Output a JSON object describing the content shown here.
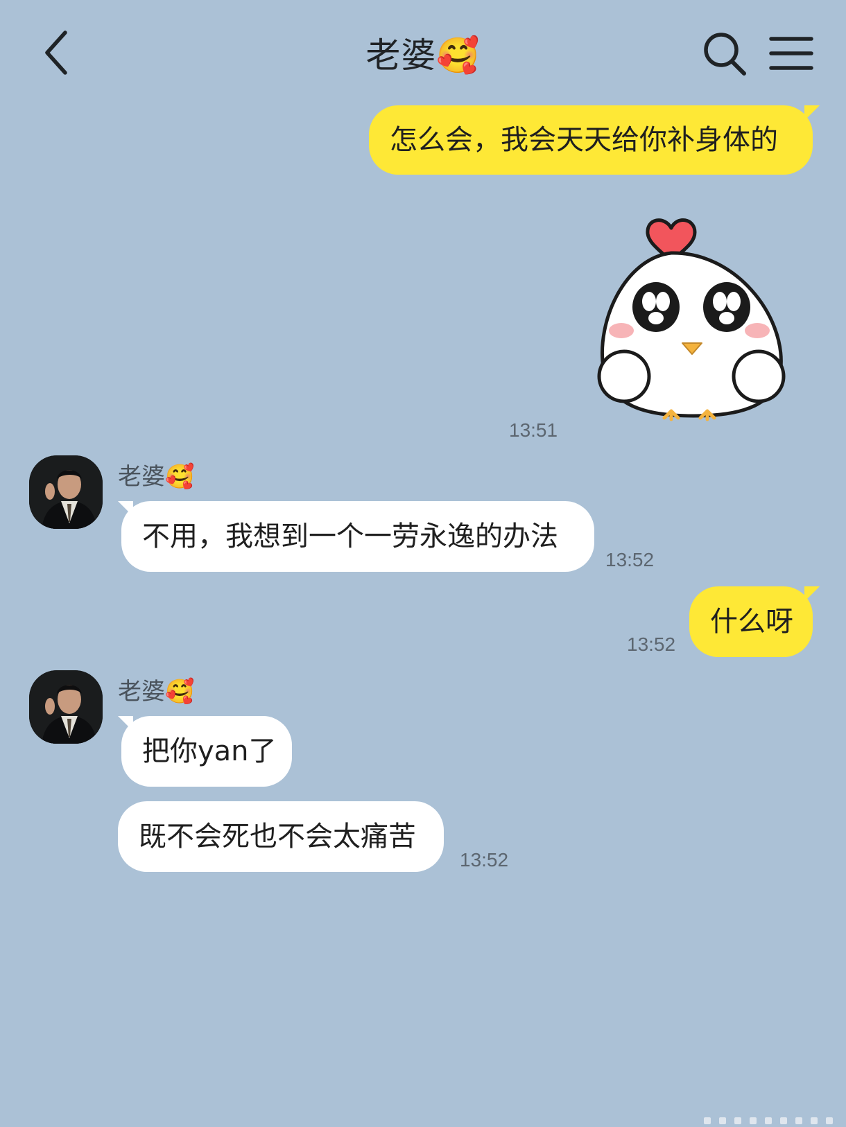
{
  "header": {
    "title": "老婆🥰",
    "back_icon": "back-chevron-icon",
    "search_icon": "search-icon",
    "menu_icon": "menu-icon"
  },
  "messages": [
    {
      "side": "mine",
      "text": "怎么会，我会天天给你补身体的"
    },
    {
      "side": "mine",
      "type": "sticker",
      "sticker": "chicken-heart-sticker",
      "time": "13:51"
    },
    {
      "side": "theirs",
      "sender": "老婆🥰",
      "text": "不用，我想到一个一劳永逸的办法",
      "time": "13:52"
    },
    {
      "side": "mine",
      "text": "什么呀",
      "time": "13:52"
    },
    {
      "side": "theirs",
      "sender": "老婆🥰",
      "text": "把你yan了"
    },
    {
      "side": "theirs",
      "text": "既不会死也不会太痛苦",
      "time": "13:52"
    }
  ],
  "colors": {
    "background": "#abc1d6",
    "mine_bubble": "#fee836",
    "theirs_bubble": "#ffffff",
    "time_text": "#5c6670"
  }
}
